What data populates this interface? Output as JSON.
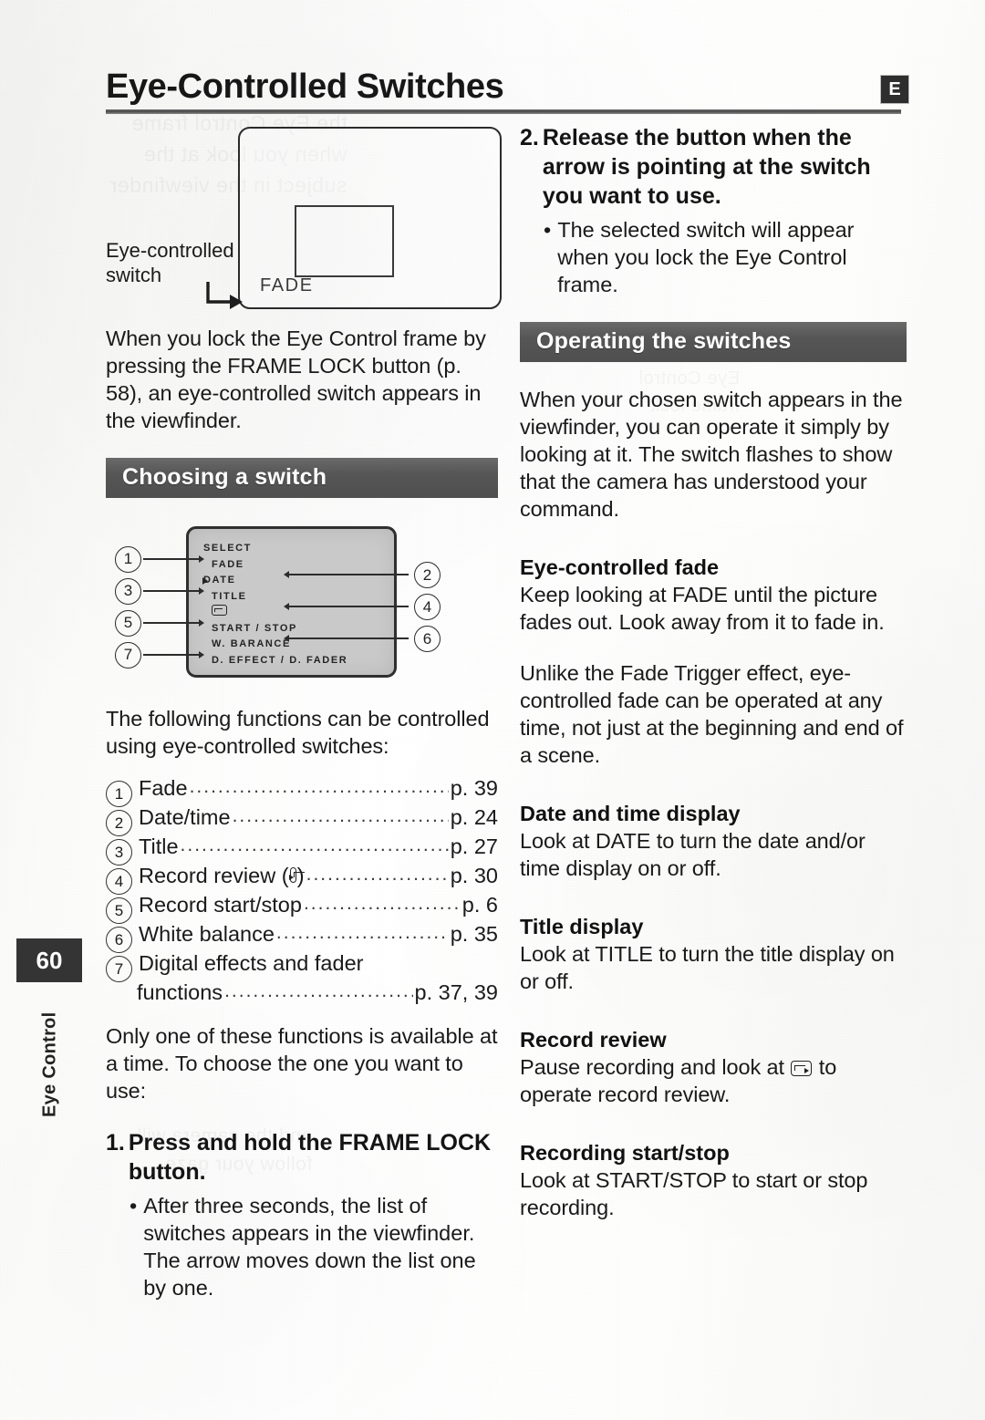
{
  "header": {
    "title": "Eye-Controlled Switches",
    "language_badge": "E"
  },
  "margin": {
    "page_number": "60",
    "chapter": "Eye Control"
  },
  "left_column": {
    "viewfinder_figure": {
      "callout_label": "Eye-controlled\nswitch",
      "switch_text": "FADE",
      "arrow_icon": "elbow-arrow-right"
    },
    "intro_paragraph": "When you lock the Eye Control frame by pressing the FRAME LOCK button (p. 58), an eye-controlled switch appears in the viewfinder.",
    "section_choosing": "Choosing a switch",
    "menu_figure": {
      "rows": [
        {
          "text": "SELECT",
          "indent": false,
          "cursor": false,
          "icon": null
        },
        {
          "text": "FADE",
          "indent": true,
          "cursor": false,
          "icon": null
        },
        {
          "text": "DATE",
          "indent": false,
          "cursor": true,
          "icon": null
        },
        {
          "text": "TITLE",
          "indent": true,
          "cursor": false,
          "icon": null
        },
        {
          "text": "",
          "indent": true,
          "cursor": false,
          "icon": "record-review-icon"
        },
        {
          "text": "START / STOP",
          "indent": true,
          "cursor": false,
          "icon": null
        },
        {
          "text": "W. BARANCE",
          "indent": true,
          "cursor": false,
          "icon": null
        },
        {
          "text": "D. EFFECT / D. FADER",
          "indent": true,
          "cursor": false,
          "icon": null
        }
      ],
      "callouts_left": [
        "1",
        "3",
        "5",
        "7"
      ],
      "callouts_right": [
        "2",
        "4",
        "6"
      ]
    },
    "functions_intro": "The following functions can be controlled using eye-controlled switches:",
    "functions": [
      {
        "num": "1",
        "label": "Fade",
        "page": "p. 39",
        "icon": null
      },
      {
        "num": "2",
        "label": "Date/time",
        "page": "p. 24",
        "icon": null
      },
      {
        "num": "3",
        "label": "Title",
        "page": "p. 27",
        "icon": null
      },
      {
        "num": "4",
        "label": "Record review (",
        "label_after": ")",
        "page": "p. 30",
        "icon": "record-review-icon"
      },
      {
        "num": "5",
        "label": "Record start/stop",
        "page": "p. 6",
        "icon": null
      },
      {
        "num": "6",
        "label": "White balance",
        "page": "p. 35",
        "icon": null
      },
      {
        "num": "7",
        "label": "Digital effects and fader",
        "page": "",
        "icon": null,
        "wrap_label": "functions",
        "wrap_page": "p. 37, 39"
      }
    ],
    "only_one_paragraph": "Only one of these functions is available at a time. To choose the one you want to use:",
    "step1": {
      "number": "1.",
      "text": "Press and hold the FRAME LOCK button.",
      "bullets": [
        "After three seconds, the list of switches appears in the viewfinder. The arrow moves down the list one by one."
      ]
    }
  },
  "right_column": {
    "step2": {
      "number": "2.",
      "text": "Release the button when the arrow is pointing at the switch you want to use.",
      "bullets": [
        "The selected switch will appear when you lock the Eye Control frame."
      ]
    },
    "section_operating": "Operating the switches",
    "operating_paragraph": "When your chosen switch appears in the viewfinder, you can operate it simply by looking at it. The switch flashes to show that the camera has understood your command.",
    "topics": [
      {
        "heading": "Eye-controlled fade",
        "paragraphs": [
          "Keep looking at FADE until the picture fades out. Look away from it to fade in.",
          "Unlike the Fade Trigger effect, eye-controlled fade can be operated at any time, not just at the beginning and end of a scene."
        ]
      },
      {
        "heading": "Date and time display",
        "paragraphs": [
          "Look at DATE to turn the date and/or time display on or off."
        ]
      },
      {
        "heading": "Title display",
        "paragraphs": [
          "Look at TITLE to turn the title display on or off."
        ]
      },
      {
        "heading": "Record review",
        "paragraphs": [],
        "rich_paragraph": {
          "before": "Pause recording and look at ",
          "icon": "record-review-icon",
          "after": " to operate record review."
        }
      },
      {
        "heading": "Recording start/stop",
        "paragraphs": [
          "Look at START/STOP to start or stop recording."
        ]
      }
    ]
  },
  "bleed_text": {
    "a": "the Eye Control frame\nwhen you look at the\nsubject in the viewfinder",
    "b": "and the camera will\nfollow your gaze",
    "c": "Eye Control\nframe lock"
  }
}
